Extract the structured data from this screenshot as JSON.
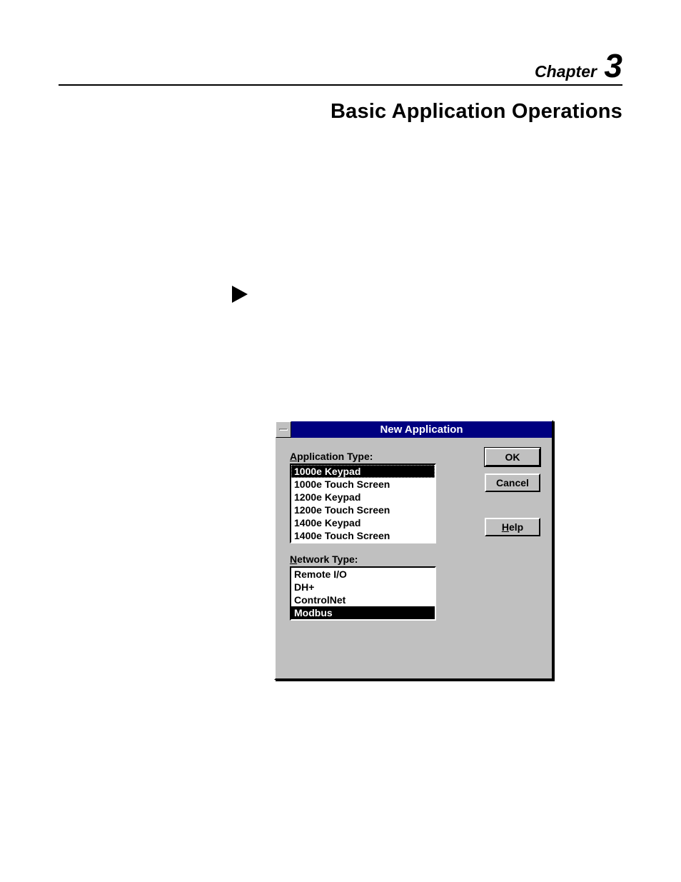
{
  "chapter": {
    "label": "Chapter",
    "number": "3"
  },
  "title": "Basic Application Operations",
  "dialog": {
    "title": "New Application",
    "appTypeLabelPrefix": "A",
    "appTypeLabelRest": "pplication Type:",
    "appTypes": [
      "1000e Keypad",
      "1000e Touch Screen",
      "1200e Keypad",
      "1200e Touch Screen",
      "1400e Keypad",
      "1400e Touch Screen"
    ],
    "netTypeLabelPrefix": "N",
    "netTypeLabelRest": "etwork Type:",
    "netTypes": [
      "Remote I/O",
      "DH+",
      "ControlNet",
      "Modbus"
    ],
    "buttons": {
      "ok": "OK",
      "cancel": "Cancel",
      "helpPrefix": "H",
      "helpRest": "elp"
    }
  }
}
